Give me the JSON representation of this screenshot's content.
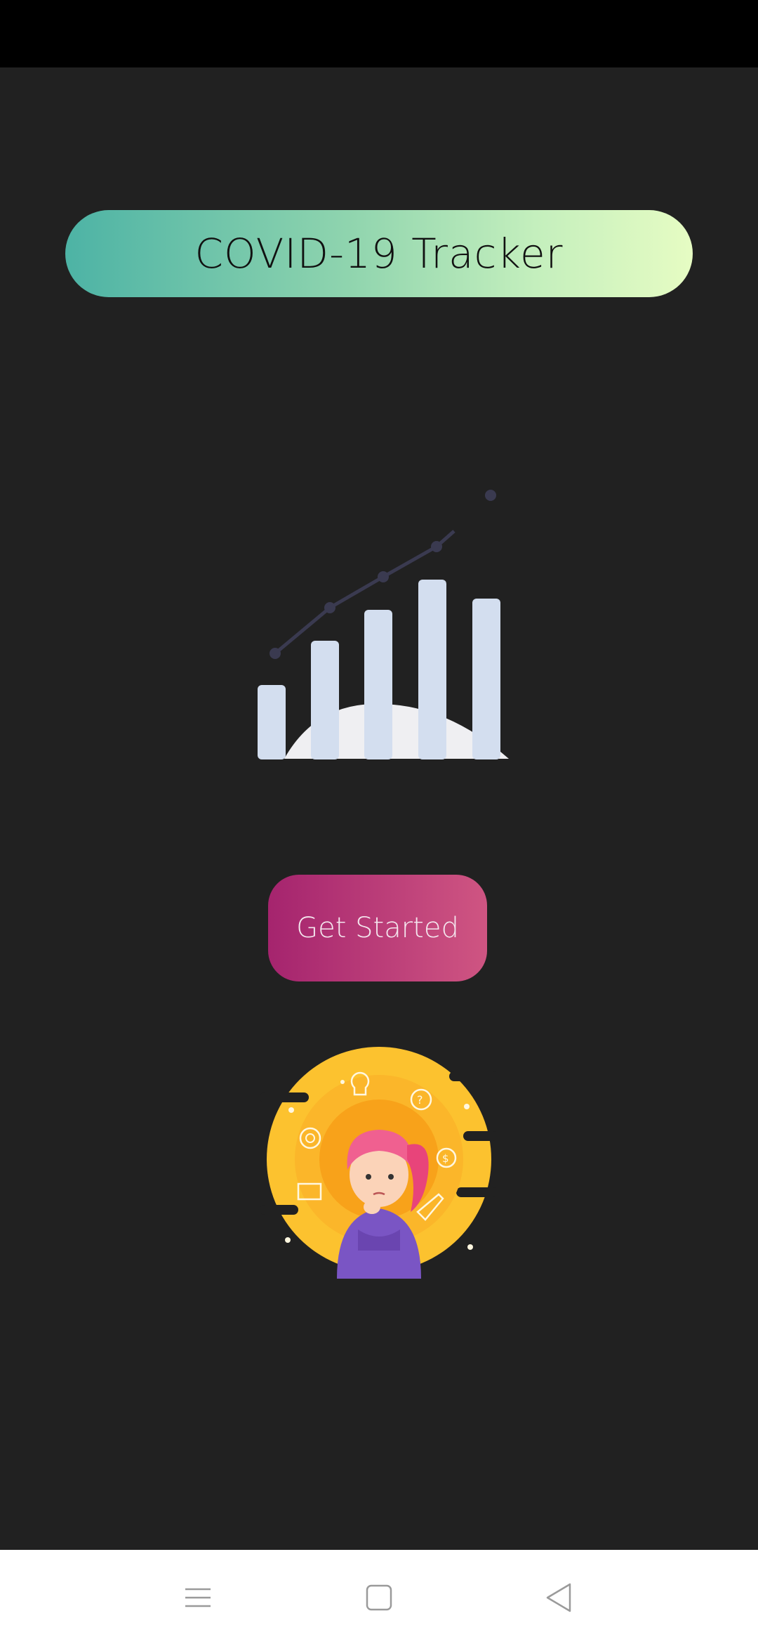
{
  "header": {
    "title": "COVID-19 Tracker"
  },
  "hero": {
    "illustration_icon": "bar-chart-trend-icon"
  },
  "actions": {
    "get_started_label": "Get Started"
  },
  "footer_art": {
    "illustration_icon": "thinking-girl-illustration"
  },
  "nav_bar": {
    "icons": [
      "menu-icon",
      "home-square-icon",
      "back-triangle-icon"
    ]
  },
  "colors": {
    "background": "#212121",
    "banner_gradient": [
      "#4db3a5",
      "#e6fcc3"
    ],
    "button_gradient": [
      "#a5246e",
      "#cf5582"
    ],
    "bars": "#d3deef",
    "trend_line": "#3a3a50",
    "illustration_yellow": "#fcc22f"
  }
}
